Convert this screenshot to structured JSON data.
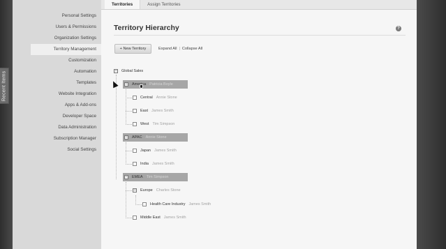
{
  "sidebar": {
    "recent_items_label": "Recent Items",
    "items": [
      {
        "label": "Personal Settings",
        "active": false
      },
      {
        "label": "Users & Permissions",
        "active": false
      },
      {
        "label": "Organization Settings",
        "active": false
      },
      {
        "label": "Territory Management",
        "active": true
      },
      {
        "label": "Customization",
        "active": false
      },
      {
        "label": "Automation",
        "active": false
      },
      {
        "label": "Templates",
        "active": false
      },
      {
        "label": "Website Integration",
        "active": false
      },
      {
        "label": "Apps & Add-ons",
        "active": false
      },
      {
        "label": "Developer Space",
        "active": false
      },
      {
        "label": "Data Administration",
        "active": false
      },
      {
        "label": "Subscription Manager",
        "active": false
      },
      {
        "label": "Social Settings",
        "active": false
      }
    ]
  },
  "tabs": [
    {
      "label": "Territories",
      "active": true
    },
    {
      "label": "Assign Territories",
      "active": false
    }
  ],
  "page": {
    "title": "Territory Hierarchy",
    "help_icon": "question-circle-icon",
    "new_button": "+ New Territory",
    "expand_all": "Expand All",
    "separator": "|",
    "collapse_all": "Collapse All"
  },
  "tree": {
    "root": "Global Sales",
    "nodes": [
      {
        "name": "America",
        "owner": "Patricia Boyle",
        "highlight": true
      },
      {
        "name": "Central",
        "owner": "Annie Stone",
        "highlight": false
      },
      {
        "name": "East",
        "owner": "James Smith",
        "highlight": false
      },
      {
        "name": "West",
        "owner": "Tim Simpson",
        "highlight": false
      },
      {
        "name": "APAC",
        "owner": "Annie Stone",
        "highlight": true
      },
      {
        "name": "Japan",
        "owner": "James Smith",
        "highlight": false
      },
      {
        "name": "India",
        "owner": "James Smith",
        "highlight": false
      },
      {
        "name": "EMEA",
        "owner": "Tim Simpson",
        "highlight": true
      },
      {
        "name": "Europe",
        "owner": "Charles Stone",
        "highlight": false
      },
      {
        "name": "Health Care Industry",
        "owner": "James Smith",
        "highlight": false
      },
      {
        "name": "Middle East",
        "owner": "James Smith",
        "highlight": false
      }
    ]
  },
  "colors": {
    "highlight_row": "#a6a6a6",
    "sidebar_bg": "#d9d9d9",
    "main_bg": "#f6f6f6"
  }
}
